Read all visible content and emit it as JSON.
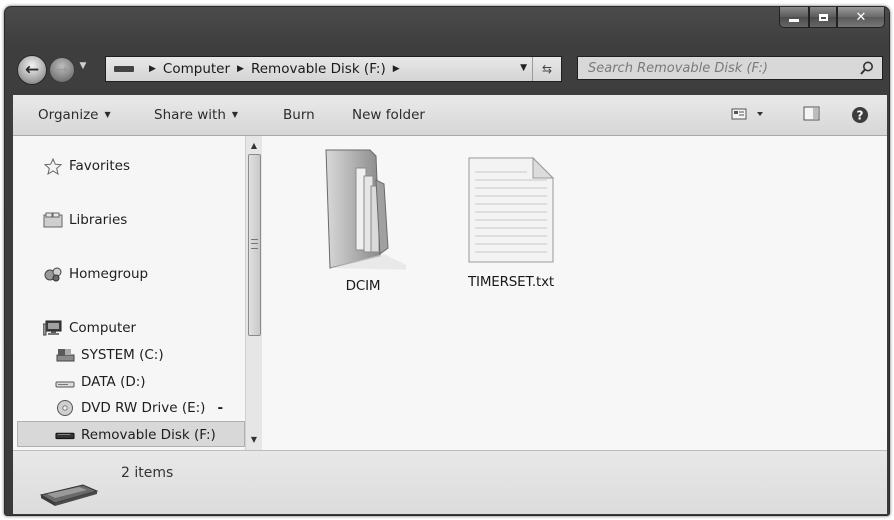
{
  "window": {
    "caption_buttons": [
      "minimize",
      "maximize",
      "close"
    ]
  },
  "nav": {
    "back_icon": "back-arrow-icon",
    "forward_icon": "forward-arrow-icon",
    "address_segments": [
      "Computer",
      "Removable Disk (F:)"
    ],
    "search_placeholder": "Search Removable Disk (F:)"
  },
  "toolbar": {
    "organize": "Organize",
    "share_with": "Share with",
    "burn": "Burn",
    "new_folder": "New folder"
  },
  "sidebar": {
    "favorites": "Favorites",
    "libraries": "Libraries",
    "homegroup": "Homegroup",
    "computer": "Computer",
    "drives": [
      "SYSTEM (C:)",
      "DATA (D:)",
      "DVD RW Drive (E:)",
      "Removable Disk (F:)"
    ],
    "selected": "Removable Disk (F:)"
  },
  "content": {
    "files": [
      {
        "name": "DCIM",
        "type": "folder"
      },
      {
        "name": "TIMERSET.txt",
        "type": "text-file"
      }
    ]
  },
  "details": {
    "item_count": "2 items"
  }
}
